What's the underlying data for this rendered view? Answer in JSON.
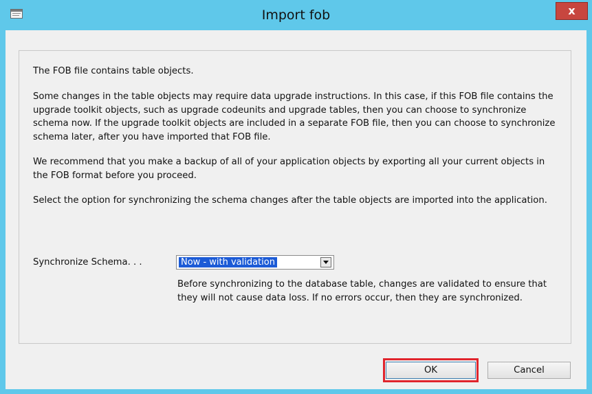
{
  "window": {
    "title": "Import fob",
    "close_label": "x"
  },
  "content": {
    "p1": "The FOB file contains table objects.",
    "p2": "Some changes in the table objects may require data upgrade instructions. In this case, if this FOB file contains the upgrade toolkit objects, such as upgrade codeunits and upgrade tables, then you can choose to synchronize schema now. If the upgrade toolkit objects are included in a separate FOB file, then you can choose to synchronize schema later, after you have imported that FOB file.",
    "p3": "We recommend that you make a backup of all of your application objects by exporting all your current objects in the FOB format before you proceed.",
    "p4": "Select the option for synchronizing the schema changes after the table objects are imported into the application."
  },
  "sync": {
    "label": "Synchronize Schema. . .",
    "selected": "Now - with validation",
    "helper": "Before synchronizing to the database table, changes are validated to ensure that they will not cause data loss. If no errors occur, then they are synchronized."
  },
  "buttons": {
    "ok": "OK",
    "cancel": "Cancel"
  },
  "colors": {
    "titlebar": "#5fc8ea",
    "close": "#c7463f",
    "selection": "#1c5bd6",
    "highlight": "#e0242c"
  }
}
